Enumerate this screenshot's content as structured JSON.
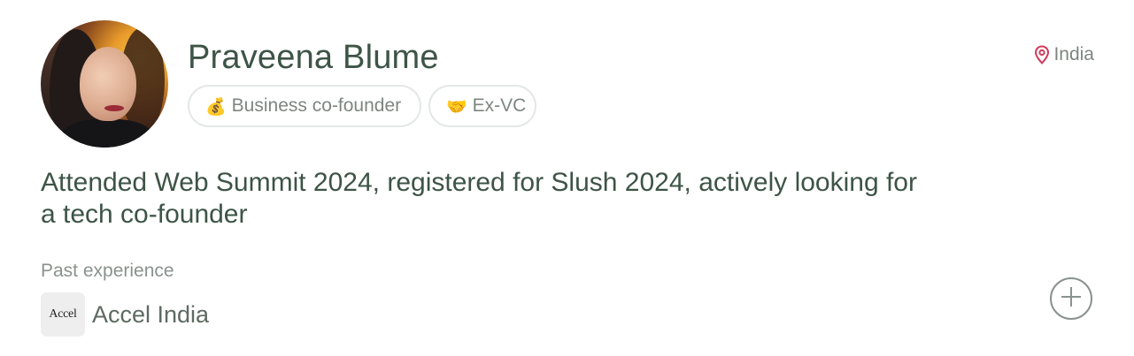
{
  "profile": {
    "name": "Praveena Blume",
    "location": "India",
    "tags": [
      {
        "emoji": "💰",
        "label": "Business co-founder",
        "icon": "money-bag-icon"
      },
      {
        "emoji": "🤝",
        "label": "Ex-VC",
        "icon": "handshake-icon"
      }
    ],
    "bio": "Attended Web Summit 2024, registered for Slush 2024, actively looking for a tech co-founder",
    "experience": {
      "label": "Past experience",
      "items": [
        {
          "logo_text": "Accel",
          "name": "Accel India"
        }
      ]
    }
  },
  "colors": {
    "name": "#3d5446",
    "location_pin": "#d23a5a",
    "muted_text": "#7d8680",
    "tag_border": "#e4e8e5"
  },
  "icons": {
    "location": "map-pin-icon",
    "add": "plus-circle-icon"
  }
}
